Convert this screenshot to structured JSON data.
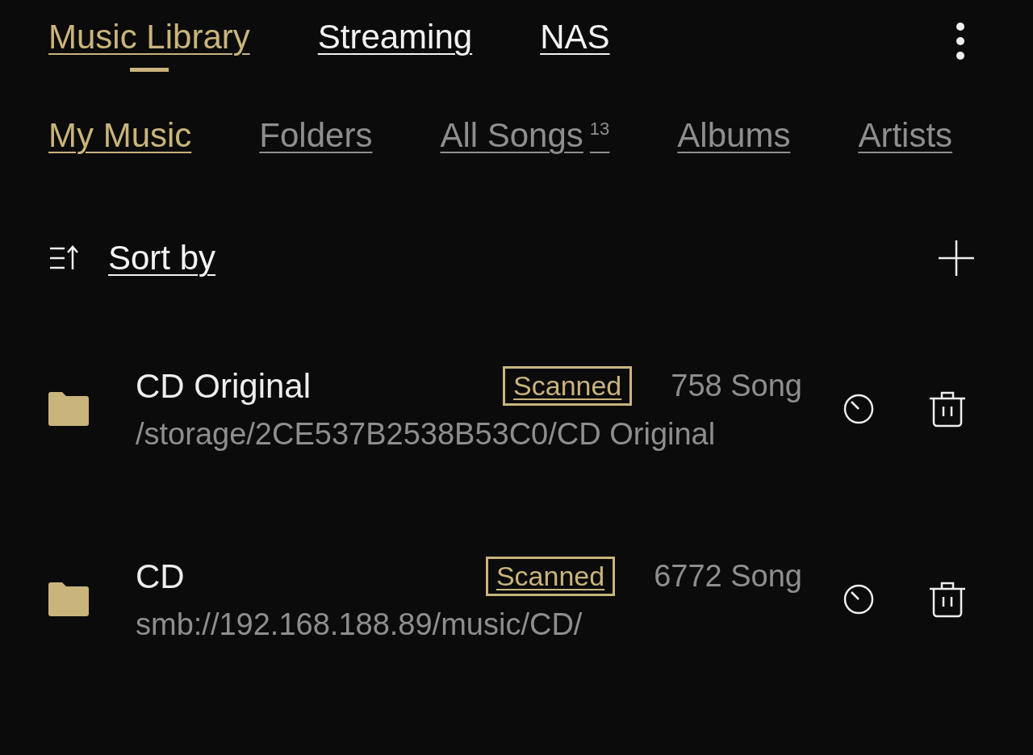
{
  "top_tabs": [
    {
      "label": "Music Library",
      "selected": true
    },
    {
      "label": "Streaming",
      "selected": false
    },
    {
      "label": "NAS",
      "selected": false
    }
  ],
  "sub_tabs": [
    {
      "label": "My Music",
      "selected": true
    },
    {
      "label": "Folders",
      "selected": false
    },
    {
      "label": "All Songs",
      "count": "13",
      "selected": false
    },
    {
      "label": "Albums",
      "selected": false
    },
    {
      "label": "Artists",
      "selected": false
    }
  ],
  "sort": {
    "label": "Sort by"
  },
  "folders": [
    {
      "name": "CD Original",
      "status": "Scanned",
      "songs": "758 Song",
      "path": "/storage/2CE537B2538B53C0/CD Original"
    },
    {
      "name": "CD",
      "status": "Scanned",
      "songs": "6772 Song",
      "path": "smb://192.168.188.89/music/CD/"
    }
  ]
}
